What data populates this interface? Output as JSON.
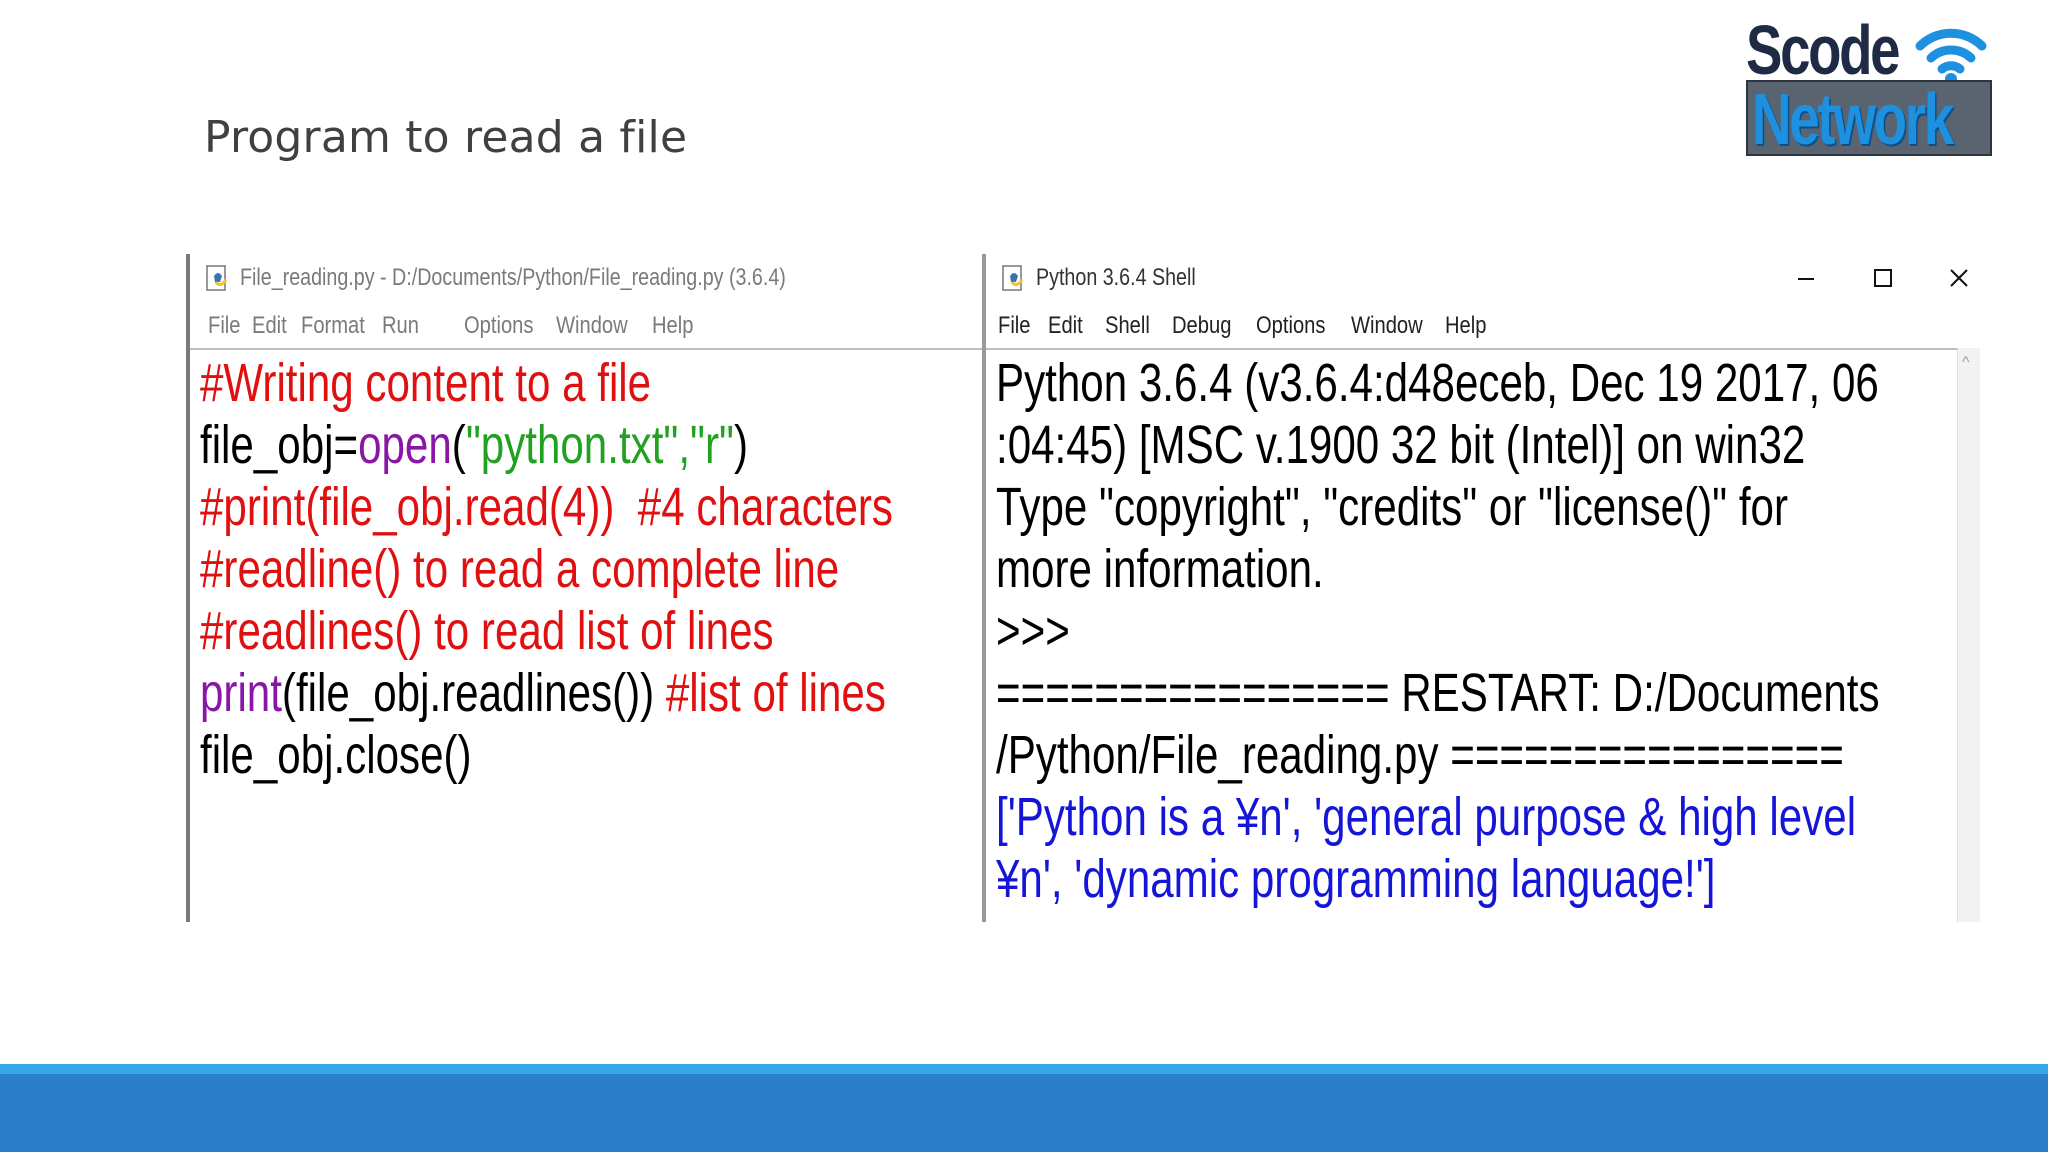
{
  "slide": {
    "title": "Program to read a file"
  },
  "logo": {
    "line1": "Scode",
    "line2": "Network",
    "icon": "wifi-icon"
  },
  "editor": {
    "title": "File_reading.py - D:/Documents/Python/File_reading.py (3.6.4)",
    "menu": [
      "File",
      "Edit",
      "Format",
      "Run",
      "Options",
      "Window",
      "Help"
    ],
    "lines": [
      [
        {
          "t": "#Writing content to a file",
          "c": "red"
        }
      ],
      [
        {
          "t": "file_obj=",
          "c": "black"
        },
        {
          "t": "open",
          "c": "purple"
        },
        {
          "t": "(",
          "c": "black"
        },
        {
          "t": "\"python.txt\",\"r\"",
          "c": "green"
        },
        {
          "t": ")",
          "c": "black"
        }
      ],
      [
        {
          "t": "#print(file_obj.read(4))  #4 characters",
          "c": "red"
        }
      ],
      [
        {
          "t": "#readline() to read a complete line",
          "c": "red"
        }
      ],
      [
        {
          "t": "#readlines() to read list of lines",
          "c": "red"
        }
      ],
      [
        {
          "t": "print",
          "c": "purple"
        },
        {
          "t": "(file_obj.readlines()) ",
          "c": "black"
        },
        {
          "t": "#list of lines",
          "c": "red"
        }
      ],
      [
        {
          "t": "file_obj.close()",
          "c": "black"
        }
      ]
    ]
  },
  "shell": {
    "title": "Python 3.6.4 Shell",
    "menu": [
      "File",
      "Edit",
      "Shell",
      "Debug",
      "Options",
      "Window",
      "Help"
    ],
    "controls": {
      "minimize": "–",
      "maximize": "☐",
      "close": "✕"
    },
    "lines": [
      [
        {
          "t": "Python 3.6.4 (v3.6.4:d48eceb, Dec 19 2017, 06",
          "c": "black"
        }
      ],
      [
        {
          "t": ":04:45) [MSC v.1900 32 bit (Intel)] on win32",
          "c": "black"
        }
      ],
      [
        {
          "t": "Type \"copyright\", \"credits\" or \"license()\" for",
          "c": "black"
        }
      ],
      [
        {
          "t": "more information.",
          "c": "black"
        }
      ],
      [
        {
          "t": ">>>",
          "c": "black"
        }
      ],
      [
        {
          "t": "================ RESTART: D:/Documents",
          "c": "black"
        }
      ],
      [
        {
          "t": "/Python/File_reading.py ================",
          "c": "black"
        }
      ],
      [
        {
          "t": "['Python is a ¥n', 'general purpose & high level",
          "c": "blue"
        }
      ],
      [
        {
          "t": "¥n', 'dynamic programming language!']",
          "c": "blue"
        }
      ],
      [
        {
          "t": ">>>",
          "c": "black"
        }
      ]
    ]
  },
  "colors": {
    "red": "#e01010",
    "purple": "#8a16a8",
    "green": "#22a022",
    "blue": "#1515d8",
    "black": "#000000",
    "footer_band": "#2b7fc8",
    "footer_line": "#35a8e8"
  }
}
